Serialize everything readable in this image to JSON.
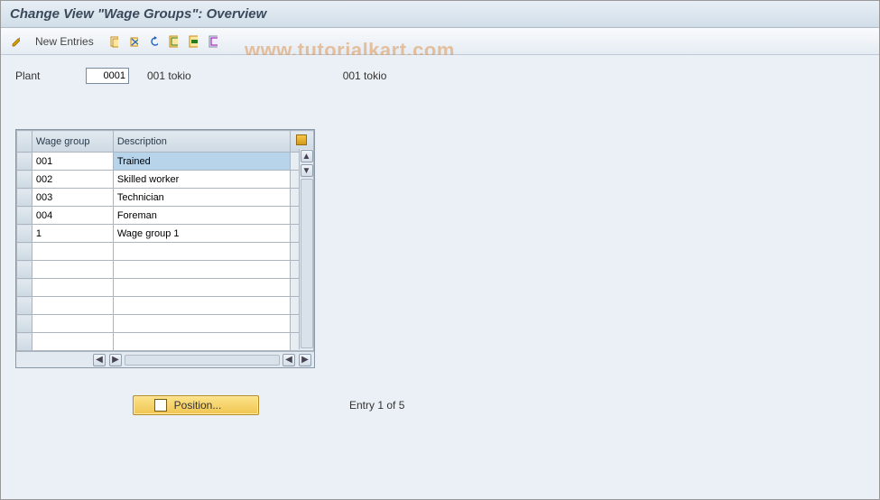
{
  "title": "Change View \"Wage Groups\": Overview",
  "toolbar": {
    "new_entries_label": "New Entries"
  },
  "plant": {
    "label": "Plant",
    "value": "0001",
    "desc1": "001 tokio",
    "desc2": "001 tokio"
  },
  "table": {
    "headers": {
      "wage_group": "Wage group",
      "description": "Description"
    },
    "rows": [
      {
        "wg": "001",
        "desc": "Trained",
        "hl": true
      },
      {
        "wg": "002",
        "desc": "Skilled worker"
      },
      {
        "wg": "003",
        "desc": "Technician"
      },
      {
        "wg": "004",
        "desc": "Foreman"
      },
      {
        "wg": "1",
        "desc": "Wage group 1"
      },
      {
        "wg": "",
        "desc": ""
      },
      {
        "wg": "",
        "desc": ""
      },
      {
        "wg": "",
        "desc": ""
      },
      {
        "wg": "",
        "desc": ""
      },
      {
        "wg": "",
        "desc": ""
      },
      {
        "wg": "",
        "desc": ""
      }
    ]
  },
  "footer": {
    "position_label": "Position...",
    "entry_text": "Entry 1 of 5"
  },
  "watermark": "www.tutorialkart.com"
}
